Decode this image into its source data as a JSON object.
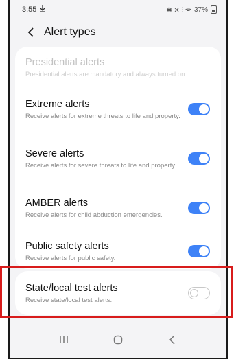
{
  "status": {
    "time": "3:55",
    "notification_icon": "download-icon",
    "right_icons": "✱ ✕ ⫶ ᯤ",
    "battery_text": "37%"
  },
  "header": {
    "back_icon": "back-chevron-icon",
    "title": "Alert types"
  },
  "alerts": [
    {
      "title": "Presidential alerts",
      "subtitle": "Presidential alerts are mandatory and always turned on.",
      "enabled": null
    },
    {
      "title": "Extreme alerts",
      "subtitle": "Receive alerts for extreme threats to life and property.",
      "enabled": true
    },
    {
      "title": "Severe alerts",
      "subtitle": "Receive alerts for severe threats to life and property.",
      "enabled": true
    },
    {
      "title": "AMBER alerts",
      "subtitle": "Receive alerts for child abduction emergencies.",
      "enabled": true
    },
    {
      "title": "Public safety alerts",
      "subtitle": "Receive alerts for public safety.",
      "enabled": true
    },
    {
      "title": "State/local test alerts",
      "subtitle": "Receive state/local test alerts.",
      "enabled": false
    }
  ],
  "colors": {
    "toggle_on": "#3e82f7",
    "highlight": "#d81c1c"
  },
  "nav": {
    "recents_icon": "recents-icon",
    "home_icon": "home-icon",
    "back_icon": "back-icon"
  }
}
